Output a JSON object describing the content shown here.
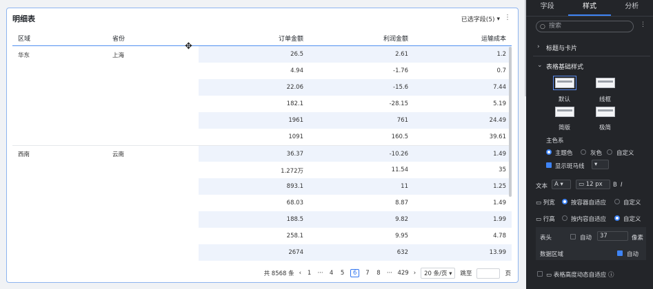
{
  "card": {
    "title": "明细表",
    "fields_label": "已选字段(5)",
    "more": "⋮"
  },
  "table": {
    "headers": [
      "区域",
      "省份",
      "订单金额",
      "利润金额",
      "运输成本"
    ],
    "groups": [
      {
        "region": "华东",
        "province": "上海",
        "rows": [
          [
            "26.5",
            "2.61",
            "1.2"
          ],
          [
            "4.94",
            "-1.76",
            "0.7"
          ],
          [
            "22.06",
            "-15.6",
            "7.44"
          ],
          [
            "182.1",
            "-28.15",
            "5.19"
          ],
          [
            "1961",
            "761",
            "24.49"
          ],
          [
            "1091",
            "160.5",
            "39.61"
          ]
        ]
      },
      {
        "region": "西南",
        "province": "云南",
        "rows": [
          [
            "36.37",
            "-10.26",
            "1.49"
          ],
          [
            "1.272万",
            "11.54",
            "35"
          ],
          [
            "893.1",
            "11",
            "1.25"
          ],
          [
            "68.03",
            "8.87",
            "1.49"
          ],
          [
            "188.5",
            "9.82",
            "1.99"
          ],
          [
            "258.1",
            "9.95",
            "4.78"
          ],
          [
            "2674",
            "632",
            "13.99"
          ]
        ]
      }
    ]
  },
  "pager": {
    "total": "共 8568 条",
    "prev": "‹",
    "pages": [
      "1",
      "···",
      "4",
      "5",
      "6",
      "7",
      "8",
      "···",
      "429"
    ],
    "active": "6",
    "next": "›",
    "page_size": "20 条/页",
    "jump_label": "跳至",
    "page_unit": "页"
  },
  "panel": {
    "tabs": [
      "字段",
      "样式",
      "分析"
    ],
    "active_tab": "样式",
    "search_placeholder": "搜索",
    "sections": {
      "title_card": "标题与卡片",
      "table_basic": "表格基础样式"
    },
    "styles": [
      "默认",
      "线框",
      "简版",
      "极简"
    ],
    "theme_label": "主色系",
    "theme_options": [
      "主题色",
      "灰色",
      "自定义"
    ],
    "zebra_label": "显示斑马线",
    "text_label": "文本",
    "font_size": "12 px",
    "font_btn_a": "A",
    "bold": "B",
    "italic": "I",
    "colwidth_label": "列宽",
    "colwidth_options": [
      "按容器自适应",
      "自定义"
    ],
    "rowheight_label": "行高",
    "rowheight_options": [
      "按内容自适应",
      "自定义"
    ],
    "header_label": "表头",
    "auto_label": "自动",
    "header_value": "37",
    "pixel_unit": "像素",
    "data_area_label": "数据区域",
    "data_auto_label": "自动",
    "dynamic_label": "表格高度动态自适应"
  },
  "colors": {
    "accent": "#3e84f6",
    "zebra": "#eef3fc",
    "panel_bg": "#232529"
  }
}
